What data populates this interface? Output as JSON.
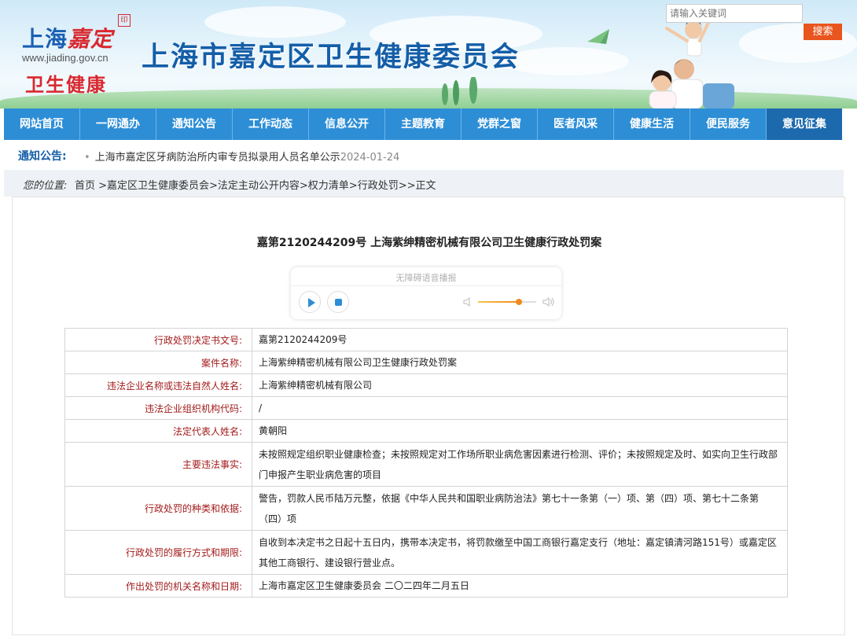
{
  "header": {
    "logo_city": "上海",
    "logo_district": "嘉定",
    "logo_url": "www.jiading.gov.cn",
    "logo_sub": "卫生健康",
    "site_title": "上海市嘉定区卫生健康委员会"
  },
  "nav": {
    "items": [
      "网站首页",
      "一网通办",
      "通知公告",
      "工作动态",
      "信息公开",
      "主题教育",
      "党群之窗",
      "医者风采",
      "健康生活",
      "便民服务",
      "意见征集"
    ],
    "active_index": 10
  },
  "notice": {
    "label": "通知公告:",
    "bullet": "•",
    "text": "上海市嘉定区牙病防治所内审专员拟录用人员名单公示",
    "date": "2024-01-24"
  },
  "search": {
    "placeholder": "请输入关键词",
    "button_label": "搜索"
  },
  "breadcrumb": {
    "label": "您的位置:",
    "path": "首页 >嘉定区卫生健康委员会>法定主动公开内容>权力清单>行政处罚>>正文"
  },
  "article": {
    "title": "嘉第2120244209号  上海紫绅精密机械有限公司卫生健康行政处罚案"
  },
  "player": {
    "caption": "无障碍语音播报",
    "volume": 0.7
  },
  "table": {
    "rows": [
      {
        "key": "行政处罚决定书文号:",
        "value": "嘉第2120244209号"
      },
      {
        "key": "案件名称:",
        "value": "上海紫绅精密机械有限公司卫生健康行政处罚案"
      },
      {
        "key": "违法企业名称或违法自然人姓名:",
        "value": "上海紫绅精密机械有限公司"
      },
      {
        "key": "违法企业组织机构代码:",
        "value": "/"
      },
      {
        "key": "法定代表人姓名:",
        "value": "黄朝阳"
      },
      {
        "key": "主要违法事实:",
        "value": "未按照规定组织职业健康检查；未按照规定对工作场所职业病危害因素进行检测、评价；未按照规定及时、如实向卫生行政部门申报产生职业病危害的项目"
      },
      {
        "key": "行政处罚的种类和依据:",
        "value": "警告，罚款人民币陆万元整，依据《中华人民共和国职业病防治法》第七十一条第（一）项、第（四）项、第七十二条第（四）项"
      },
      {
        "key": "行政处罚的履行方式和期限:",
        "value": "自收到本决定书之日起十五日内，携带本决定书，将罚款缴至中国工商银行嘉定支行（地址：嘉定镇清河路151号）或嘉定区其他工商银行、建设银行营业点。"
      },
      {
        "key": "作出处罚的机关名称和日期:",
        "value": "上海市嘉定区卫生健康委员会 二〇二四年二月五日"
      }
    ]
  }
}
